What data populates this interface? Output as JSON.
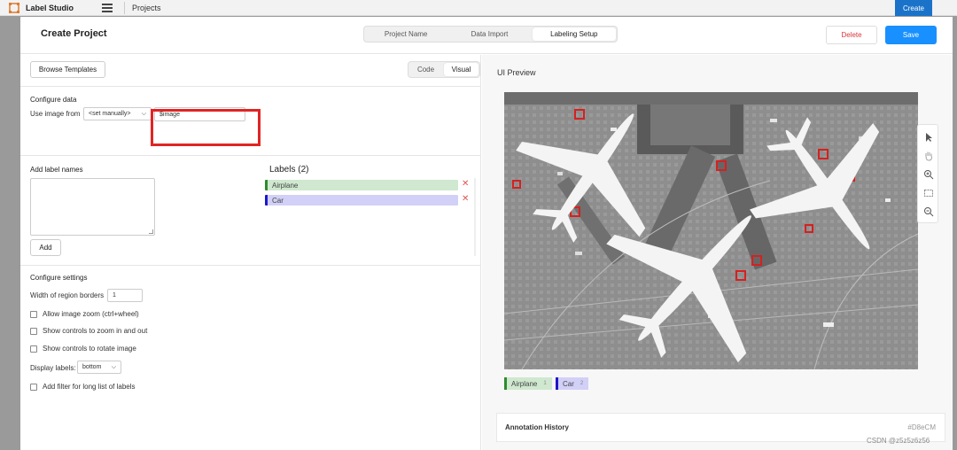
{
  "topbar": {
    "brand": "Label Studio",
    "crumb": "Projects",
    "create_label": "Create"
  },
  "modal": {
    "title": "Create Project",
    "steps": [
      {
        "label": "Project Name",
        "active": false
      },
      {
        "label": "Data Import",
        "active": false
      },
      {
        "label": "Labeling Setup",
        "active": true
      }
    ],
    "delete_label": "Delete",
    "save_label": "Save"
  },
  "left": {
    "browse_label": "Browse Templates",
    "view_toggle": {
      "code": "Code",
      "visual": "Visual",
      "selected": "Visual"
    },
    "configure_data": {
      "title": "Configure data",
      "use_from_label": "Use image from",
      "source_select": "<set manually>",
      "value": "$image"
    },
    "add_labels": {
      "title": "Add label names",
      "textarea_value": "",
      "add_label": "Add"
    },
    "labels": {
      "title": "Labels (2)",
      "items": [
        {
          "name": "Airplane",
          "bg": "#cfe8cf",
          "border": "#2e8b2e"
        },
        {
          "name": "Car",
          "bg": "#d2d0f7",
          "border": "#1d18c9"
        }
      ]
    },
    "configure_settings": {
      "title": "Configure settings",
      "border_width_label": "Width of region borders",
      "border_width_value": "1",
      "options": [
        "Allow image zoom (ctrl+wheel)",
        "Show controls to zoom in and out",
        "Show controls to rotate image"
      ],
      "display_labels_label": "Display labels:",
      "display_labels_value": "bottom",
      "filter_label": "Add filter for long list of labels"
    }
  },
  "right": {
    "preview_title": "UI Preview",
    "tags": [
      {
        "name": "Airplane",
        "count": "1",
        "bg": "#cfe8cf",
        "border": "#2e8b2e"
      },
      {
        "name": "Car",
        "count": "2",
        "bg": "#d2d0f7",
        "border": "#1d18c9"
      }
    ],
    "history_title": "Annotation History",
    "history_id": "#D8eCM"
  },
  "watermark": "CSDN @z5z5z6z56",
  "colors": {
    "accent": "#1890ff",
    "danger": "#d9363e",
    "highlight": "#e02424"
  }
}
